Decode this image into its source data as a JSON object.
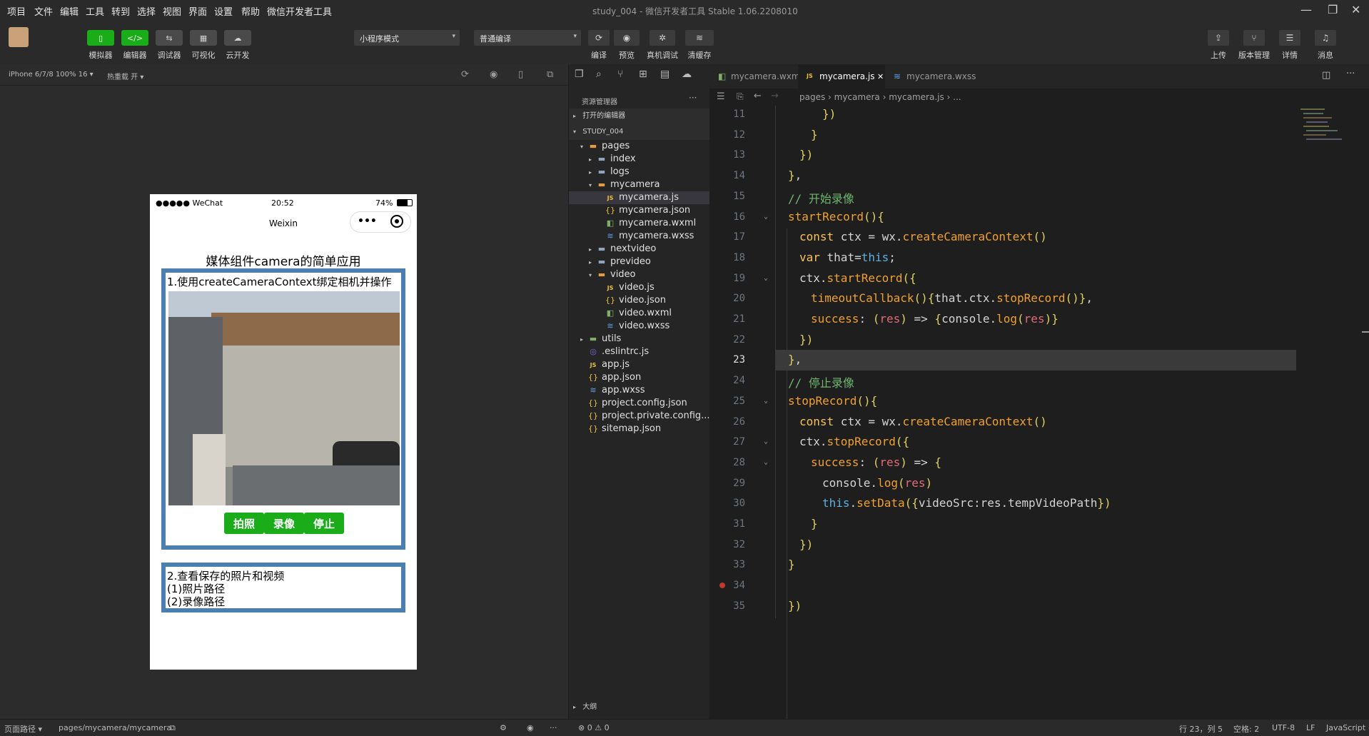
{
  "window": {
    "title": "study_004 - 微信开发者工具 Stable 1.06.2208010",
    "menu": [
      "项目",
      "文件",
      "编辑",
      "工具",
      "转到",
      "选择",
      "视图",
      "界面",
      "设置",
      "帮助",
      "微信开发者工具"
    ]
  },
  "toolbar": {
    "left_buttons": [
      {
        "label": "模拟器",
        "icon": "phone-icon",
        "active": true
      },
      {
        "label": "编辑器",
        "icon": "code-icon",
        "active": true
      },
      {
        "label": "调试器",
        "icon": "debug-icon",
        "active": false
      },
      {
        "label": "可视化",
        "icon": "layout-icon",
        "active": false
      },
      {
        "label": "云开发",
        "icon": "cloud-icon",
        "active": false
      }
    ],
    "mode_select": "小程序模式",
    "compile_select": "普通编译",
    "center_buttons": [
      {
        "label": "编译",
        "icon": "refresh-icon"
      },
      {
        "label": "预览",
        "icon": "eye-icon"
      },
      {
        "label": "真机调试",
        "icon": "bug-icon"
      },
      {
        "label": "清缓存",
        "icon": "layers-icon"
      }
    ],
    "right_buttons": [
      {
        "label": "上传",
        "icon": "upload-icon"
      },
      {
        "label": "版本管理",
        "icon": "branch-icon"
      },
      {
        "label": "详情",
        "icon": "menu-icon"
      },
      {
        "label": "消息",
        "icon": "bell-icon"
      }
    ]
  },
  "simulator": {
    "device": "iPhone 6/7/8 100% 16",
    "hotreload": "热重载 开",
    "phone": {
      "carrier": "●●●●● WeChat",
      "time": "20:52",
      "battery": "74%",
      "nav_title": "Weixin",
      "page_title": "媒体组件camera的简单应用",
      "section1_title": "1.使用createCameraContext绑定相机并操作",
      "buttons": [
        "拍照",
        "录像",
        "停止"
      ],
      "section2_lines": [
        "2.查看保存的照片和视频",
        "(1)照片路径",
        "(2)录像路径"
      ]
    }
  },
  "statusbar": {
    "page_path_label": "页面路径",
    "page_path": "pages/mycamera/mycamera",
    "problems": "⊗ 0 ⚠ 0",
    "cursor": "行 23，列 5",
    "indent": "空格: 2",
    "encoding": "UTF-8",
    "eol": "LF",
    "language": "JavaScript"
  },
  "explorer": {
    "title": "资源管理器",
    "open_editors": "打开的编辑器",
    "project": "STUDY_004",
    "outline": "大纲",
    "tree": [
      {
        "label": "pages",
        "depth": 1,
        "type": "folder-open",
        "twisty": "▾"
      },
      {
        "label": "index",
        "depth": 2,
        "type": "folder",
        "twisty": "▸"
      },
      {
        "label": "logs",
        "depth": 2,
        "type": "folder",
        "twisty": "▸"
      },
      {
        "label": "mycamera",
        "depth": 2,
        "type": "folder-open",
        "twisty": "▾"
      },
      {
        "label": "mycamera.js",
        "depth": 3,
        "type": "js",
        "twisty": "",
        "selected": true
      },
      {
        "label": "mycamera.json",
        "depth": 3,
        "type": "json",
        "twisty": ""
      },
      {
        "label": "mycamera.wxml",
        "depth": 3,
        "type": "wxml",
        "twisty": ""
      },
      {
        "label": "mycamera.wxss",
        "depth": 3,
        "type": "wxss",
        "twisty": ""
      },
      {
        "label": "nextvideo",
        "depth": 2,
        "type": "folder",
        "twisty": "▸"
      },
      {
        "label": "prevideo",
        "depth": 2,
        "type": "folder",
        "twisty": "▸"
      },
      {
        "label": "video",
        "depth": 2,
        "type": "folder-open",
        "twisty": "▾"
      },
      {
        "label": "video.js",
        "depth": 3,
        "type": "js",
        "twisty": ""
      },
      {
        "label": "video.json",
        "depth": 3,
        "type": "json",
        "twisty": ""
      },
      {
        "label": "video.wxml",
        "depth": 3,
        "type": "wxml",
        "twisty": ""
      },
      {
        "label": "video.wxss",
        "depth": 3,
        "type": "wxss",
        "twisty": ""
      },
      {
        "label": "utils",
        "depth": 1,
        "type": "folder-green",
        "twisty": "▸"
      },
      {
        "label": ".eslintrc.js",
        "depth": 1,
        "type": "eslint",
        "twisty": ""
      },
      {
        "label": "app.js",
        "depth": 1,
        "type": "js",
        "twisty": ""
      },
      {
        "label": "app.json",
        "depth": 1,
        "type": "json",
        "twisty": ""
      },
      {
        "label": "app.wxss",
        "depth": 1,
        "type": "wxss",
        "twisty": ""
      },
      {
        "label": "project.config.json",
        "depth": 1,
        "type": "json",
        "twisty": ""
      },
      {
        "label": "project.private.config...",
        "depth": 1,
        "type": "json",
        "twisty": ""
      },
      {
        "label": "sitemap.json",
        "depth": 1,
        "type": "json",
        "twisty": ""
      }
    ]
  },
  "editor": {
    "tabs": [
      {
        "label": "mycamera.wxml",
        "type": "wxml",
        "active": false
      },
      {
        "label": "mycamera.js",
        "type": "js",
        "active": true
      },
      {
        "label": "mycamera.wxss",
        "type": "wxss",
        "active": false
      }
    ],
    "breadcrumb": [
      "pages",
      "mycamera",
      "mycamera.js",
      "..."
    ],
    "current_line": 23,
    "lines": [
      {
        "n": "11",
        "indent": 3,
        "text": "})"
      },
      {
        "n": "12",
        "indent": 2,
        "text": "}"
      },
      {
        "n": "13",
        "indent": 1,
        "text": "})"
      },
      {
        "n": "14",
        "indent": 0,
        "text": "},"
      },
      {
        "n": "15",
        "indent": 0,
        "text": "// 开始录像"
      },
      {
        "n": "16",
        "indent": 0,
        "text": "startRecord(){"
      },
      {
        "n": "17",
        "indent": 1,
        "text": "const ctx = wx.createCameraContext()"
      },
      {
        "n": "18",
        "indent": 1,
        "text": "var that=this;"
      },
      {
        "n": "19",
        "indent": 1,
        "text": "ctx.startRecord({"
      },
      {
        "n": "20",
        "indent": 2,
        "text": "timeoutCallback(){that.ctx.stopRecord()},"
      },
      {
        "n": "21",
        "indent": 2,
        "text": "success: (res) => {console.log(res)}"
      },
      {
        "n": "22",
        "indent": 1,
        "text": "})"
      },
      {
        "n": "23",
        "indent": 0,
        "text": "},"
      },
      {
        "n": "24",
        "indent": 0,
        "text": "// 停止录像"
      },
      {
        "n": "25",
        "indent": 0,
        "text": "stopRecord(){"
      },
      {
        "n": "26",
        "indent": 1,
        "text": "const ctx = wx.createCameraContext()"
      },
      {
        "n": "27",
        "indent": 1,
        "text": "ctx.stopRecord({"
      },
      {
        "n": "28",
        "indent": 2,
        "text": "success: (res) => {"
      },
      {
        "n": "29",
        "indent": 3,
        "text": "console.log(res)"
      },
      {
        "n": "30",
        "indent": 3,
        "text": "this.setData({videoSrc:res.tempVideoPath})"
      },
      {
        "n": "31",
        "indent": 2,
        "text": "}"
      },
      {
        "n": "32",
        "indent": 1,
        "text": "})"
      },
      {
        "n": "33",
        "indent": 0,
        "text": "}"
      },
      {
        "n": "34",
        "indent": 0,
        "text": ""
      },
      {
        "n": "35",
        "indent": 0,
        "text": "})"
      }
    ]
  },
  "colors": {
    "accent_green": "#1aad19",
    "frame_blue": "#4a7fb0",
    "editor_bg": "#1e1e1e"
  }
}
